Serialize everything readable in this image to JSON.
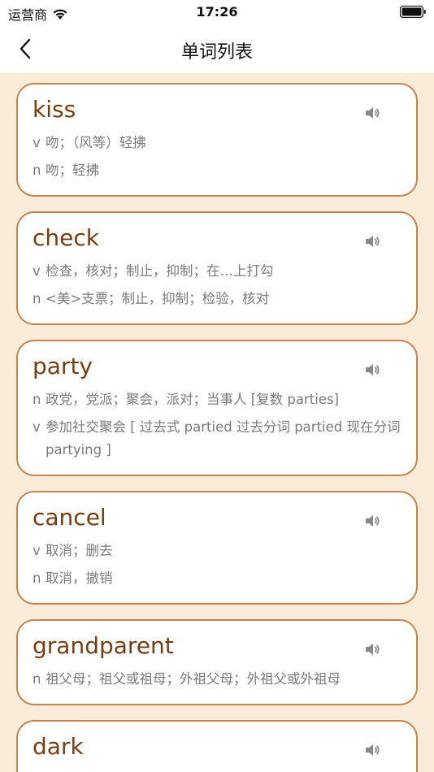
{
  "status": {
    "carrier": "运营商",
    "time": "17:26"
  },
  "nav": {
    "title": "单词列表"
  },
  "words": [
    {
      "word": "kiss",
      "defs": [
        {
          "pos": "v",
          "text": "吻；（风等）轻拂"
        },
        {
          "pos": "n",
          "text": "吻；轻拂"
        }
      ]
    },
    {
      "word": "check",
      "defs": [
        {
          "pos": "v",
          "text": "检查，核对；制止，抑制；在…上打勾"
        },
        {
          "pos": "n",
          "text": "<美>支票；制止，抑制；检验，核对"
        }
      ]
    },
    {
      "word": "party",
      "defs": [
        {
          "pos": "n",
          "text": "政党，党派；聚会，派对；当事人 [复数 parties]"
        },
        {
          "pos": "v",
          "text": "参加社交聚会 [ 过去式 partied 过去分词 partied 现在分词 partying ]"
        }
      ]
    },
    {
      "word": "cancel",
      "defs": [
        {
          "pos": "v",
          "text": "取消；删去"
        },
        {
          "pos": "n",
          "text": "取消，撤销"
        }
      ]
    },
    {
      "word": "grandparent",
      "defs": [
        {
          "pos": "n",
          "text": "祖父母；祖父或祖母；外祖父母；外祖父或外祖母"
        }
      ]
    },
    {
      "word": "dark",
      "defs": []
    }
  ]
}
